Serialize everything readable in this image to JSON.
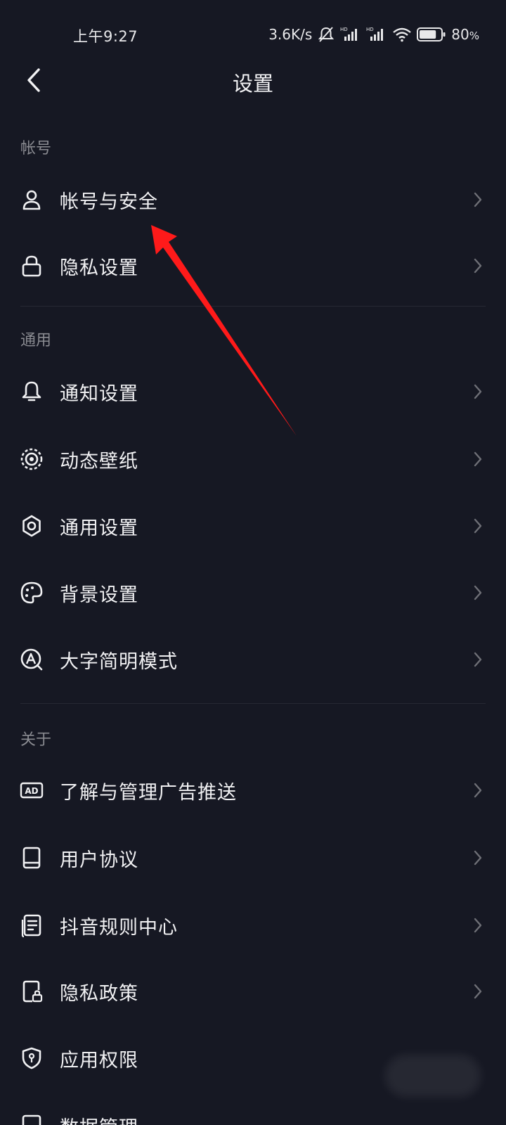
{
  "status_bar": {
    "time": "上午9:27",
    "network_speed": "3.6K/s",
    "battery_percent": "80",
    "battery_unit": "%",
    "battery_level": 0.8,
    "icons": [
      "mute-icon",
      "signal-hd-icon",
      "signal-hd-icon",
      "wifi-icon",
      "battery-icon"
    ]
  },
  "header": {
    "back_icon": "chevron-left-icon",
    "title": "设置"
  },
  "sections": [
    {
      "title": "帐号",
      "items": [
        {
          "label": "帐号与安全",
          "icon": "user-icon"
        },
        {
          "label": "隐私设置",
          "icon": "lock-icon"
        }
      ]
    },
    {
      "title": "通用",
      "items": [
        {
          "label": "通知设置",
          "icon": "bell-icon"
        },
        {
          "label": "动态壁纸",
          "icon": "live-wallpaper-icon"
        },
        {
          "label": "通用设置",
          "icon": "gear-icon"
        },
        {
          "label": "背景设置",
          "icon": "palette-icon"
        },
        {
          "label": "大字简明模式",
          "icon": "large-text-icon"
        }
      ]
    },
    {
      "title": "关于",
      "items": [
        {
          "label": "了解与管理广告推送",
          "icon": "ad-icon"
        },
        {
          "label": "用户协议",
          "icon": "book-icon"
        },
        {
          "label": "抖音规则中心",
          "icon": "rules-document-icon"
        },
        {
          "label": "隐私政策",
          "icon": "privacy-document-icon"
        },
        {
          "label": "应用权限",
          "icon": "shield-icon"
        },
        {
          "label": "数据管理",
          "icon": "data-icon"
        }
      ]
    }
  ],
  "colors": {
    "background": "#161823",
    "text_primary": "#f1f1f3",
    "text_secondary": "#8a8b91",
    "divider": "#262833",
    "chevron": "#6e6f76",
    "annotation_arrow": "#ff1a1a"
  }
}
